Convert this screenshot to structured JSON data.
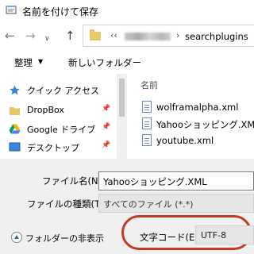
{
  "window": {
    "title": "名前を付けて保存",
    "icon": "notepad-icon"
  },
  "nav": {
    "back": "←",
    "forward": "→",
    "recent": "∨",
    "up": "↑",
    "address_prefix": "‹‹",
    "address_separator": "›",
    "address_current": "searchplugins"
  },
  "toolbar": {
    "organize_label": "整理",
    "organize_caret": "▼",
    "new_folder_label": "新しいフォルダー"
  },
  "tree": {
    "items": [
      {
        "label": "クイック アクセス",
        "icon": "star-icon",
        "pinned": false
      },
      {
        "label": "DropBox",
        "icon": "folder-icon",
        "pinned": true
      },
      {
        "label": "Google ドライブ",
        "icon": "google-drive-icon",
        "pinned": true
      },
      {
        "label": "デスクトップ",
        "icon": "desktop-icon",
        "pinned": true
      }
    ],
    "pin_glyph": "📌"
  },
  "filelist": {
    "column_header": "名前",
    "files": [
      {
        "name": "wolframalpha.xml"
      },
      {
        "name": "Yahooショッピング.XML"
      },
      {
        "name": "youtube.xml"
      }
    ]
  },
  "form": {
    "filename_label": "ファイル名(N):",
    "filename_value": "Yahooショッピング.XML",
    "filetype_label": "ファイルの種類(T):",
    "filetype_value": "すべてのファイル (*.*)",
    "encoding_label": "文字コード(E):",
    "encoding_value": "UTF-8",
    "hide_folders_label": "フォルダーの非表示"
  },
  "colors": {
    "highlight": "#c23b22",
    "folder": "#e9c667",
    "accent": "#3465a4"
  }
}
